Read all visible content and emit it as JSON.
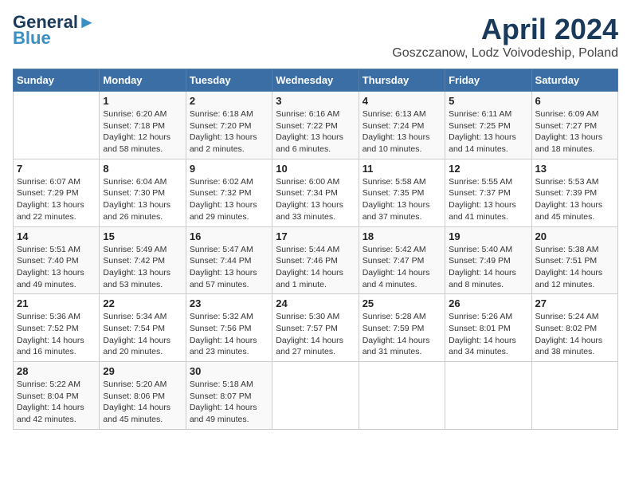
{
  "header": {
    "logo_line1": "General",
    "logo_line2": "Blue",
    "month": "April 2024",
    "location": "Goszczanow, Lodz Voivodeship, Poland"
  },
  "weekdays": [
    "Sunday",
    "Monday",
    "Tuesday",
    "Wednesday",
    "Thursday",
    "Friday",
    "Saturday"
  ],
  "weeks": [
    [
      {
        "day": "",
        "info": ""
      },
      {
        "day": "1",
        "info": "Sunrise: 6:20 AM\nSunset: 7:18 PM\nDaylight: 12 hours\nand 58 minutes."
      },
      {
        "day": "2",
        "info": "Sunrise: 6:18 AM\nSunset: 7:20 PM\nDaylight: 13 hours\nand 2 minutes."
      },
      {
        "day": "3",
        "info": "Sunrise: 6:16 AM\nSunset: 7:22 PM\nDaylight: 13 hours\nand 6 minutes."
      },
      {
        "day": "4",
        "info": "Sunrise: 6:13 AM\nSunset: 7:24 PM\nDaylight: 13 hours\nand 10 minutes."
      },
      {
        "day": "5",
        "info": "Sunrise: 6:11 AM\nSunset: 7:25 PM\nDaylight: 13 hours\nand 14 minutes."
      },
      {
        "day": "6",
        "info": "Sunrise: 6:09 AM\nSunset: 7:27 PM\nDaylight: 13 hours\nand 18 minutes."
      }
    ],
    [
      {
        "day": "7",
        "info": "Sunrise: 6:07 AM\nSunset: 7:29 PM\nDaylight: 13 hours\nand 22 minutes."
      },
      {
        "day": "8",
        "info": "Sunrise: 6:04 AM\nSunset: 7:30 PM\nDaylight: 13 hours\nand 26 minutes."
      },
      {
        "day": "9",
        "info": "Sunrise: 6:02 AM\nSunset: 7:32 PM\nDaylight: 13 hours\nand 29 minutes."
      },
      {
        "day": "10",
        "info": "Sunrise: 6:00 AM\nSunset: 7:34 PM\nDaylight: 13 hours\nand 33 minutes."
      },
      {
        "day": "11",
        "info": "Sunrise: 5:58 AM\nSunset: 7:35 PM\nDaylight: 13 hours\nand 37 minutes."
      },
      {
        "day": "12",
        "info": "Sunrise: 5:55 AM\nSunset: 7:37 PM\nDaylight: 13 hours\nand 41 minutes."
      },
      {
        "day": "13",
        "info": "Sunrise: 5:53 AM\nSunset: 7:39 PM\nDaylight: 13 hours\nand 45 minutes."
      }
    ],
    [
      {
        "day": "14",
        "info": "Sunrise: 5:51 AM\nSunset: 7:40 PM\nDaylight: 13 hours\nand 49 minutes."
      },
      {
        "day": "15",
        "info": "Sunrise: 5:49 AM\nSunset: 7:42 PM\nDaylight: 13 hours\nand 53 minutes."
      },
      {
        "day": "16",
        "info": "Sunrise: 5:47 AM\nSunset: 7:44 PM\nDaylight: 13 hours\nand 57 minutes."
      },
      {
        "day": "17",
        "info": "Sunrise: 5:44 AM\nSunset: 7:46 PM\nDaylight: 14 hours\nand 1 minute."
      },
      {
        "day": "18",
        "info": "Sunrise: 5:42 AM\nSunset: 7:47 PM\nDaylight: 14 hours\nand 4 minutes."
      },
      {
        "day": "19",
        "info": "Sunrise: 5:40 AM\nSunset: 7:49 PM\nDaylight: 14 hours\nand 8 minutes."
      },
      {
        "day": "20",
        "info": "Sunrise: 5:38 AM\nSunset: 7:51 PM\nDaylight: 14 hours\nand 12 minutes."
      }
    ],
    [
      {
        "day": "21",
        "info": "Sunrise: 5:36 AM\nSunset: 7:52 PM\nDaylight: 14 hours\nand 16 minutes."
      },
      {
        "day": "22",
        "info": "Sunrise: 5:34 AM\nSunset: 7:54 PM\nDaylight: 14 hours\nand 20 minutes."
      },
      {
        "day": "23",
        "info": "Sunrise: 5:32 AM\nSunset: 7:56 PM\nDaylight: 14 hours\nand 23 minutes."
      },
      {
        "day": "24",
        "info": "Sunrise: 5:30 AM\nSunset: 7:57 PM\nDaylight: 14 hours\nand 27 minutes."
      },
      {
        "day": "25",
        "info": "Sunrise: 5:28 AM\nSunset: 7:59 PM\nDaylight: 14 hours\nand 31 minutes."
      },
      {
        "day": "26",
        "info": "Sunrise: 5:26 AM\nSunset: 8:01 PM\nDaylight: 14 hours\nand 34 minutes."
      },
      {
        "day": "27",
        "info": "Sunrise: 5:24 AM\nSunset: 8:02 PM\nDaylight: 14 hours\nand 38 minutes."
      }
    ],
    [
      {
        "day": "28",
        "info": "Sunrise: 5:22 AM\nSunset: 8:04 PM\nDaylight: 14 hours\nand 42 minutes."
      },
      {
        "day": "29",
        "info": "Sunrise: 5:20 AM\nSunset: 8:06 PM\nDaylight: 14 hours\nand 45 minutes."
      },
      {
        "day": "30",
        "info": "Sunrise: 5:18 AM\nSunset: 8:07 PM\nDaylight: 14 hours\nand 49 minutes."
      },
      {
        "day": "",
        "info": ""
      },
      {
        "day": "",
        "info": ""
      },
      {
        "day": "",
        "info": ""
      },
      {
        "day": "",
        "info": ""
      }
    ]
  ]
}
